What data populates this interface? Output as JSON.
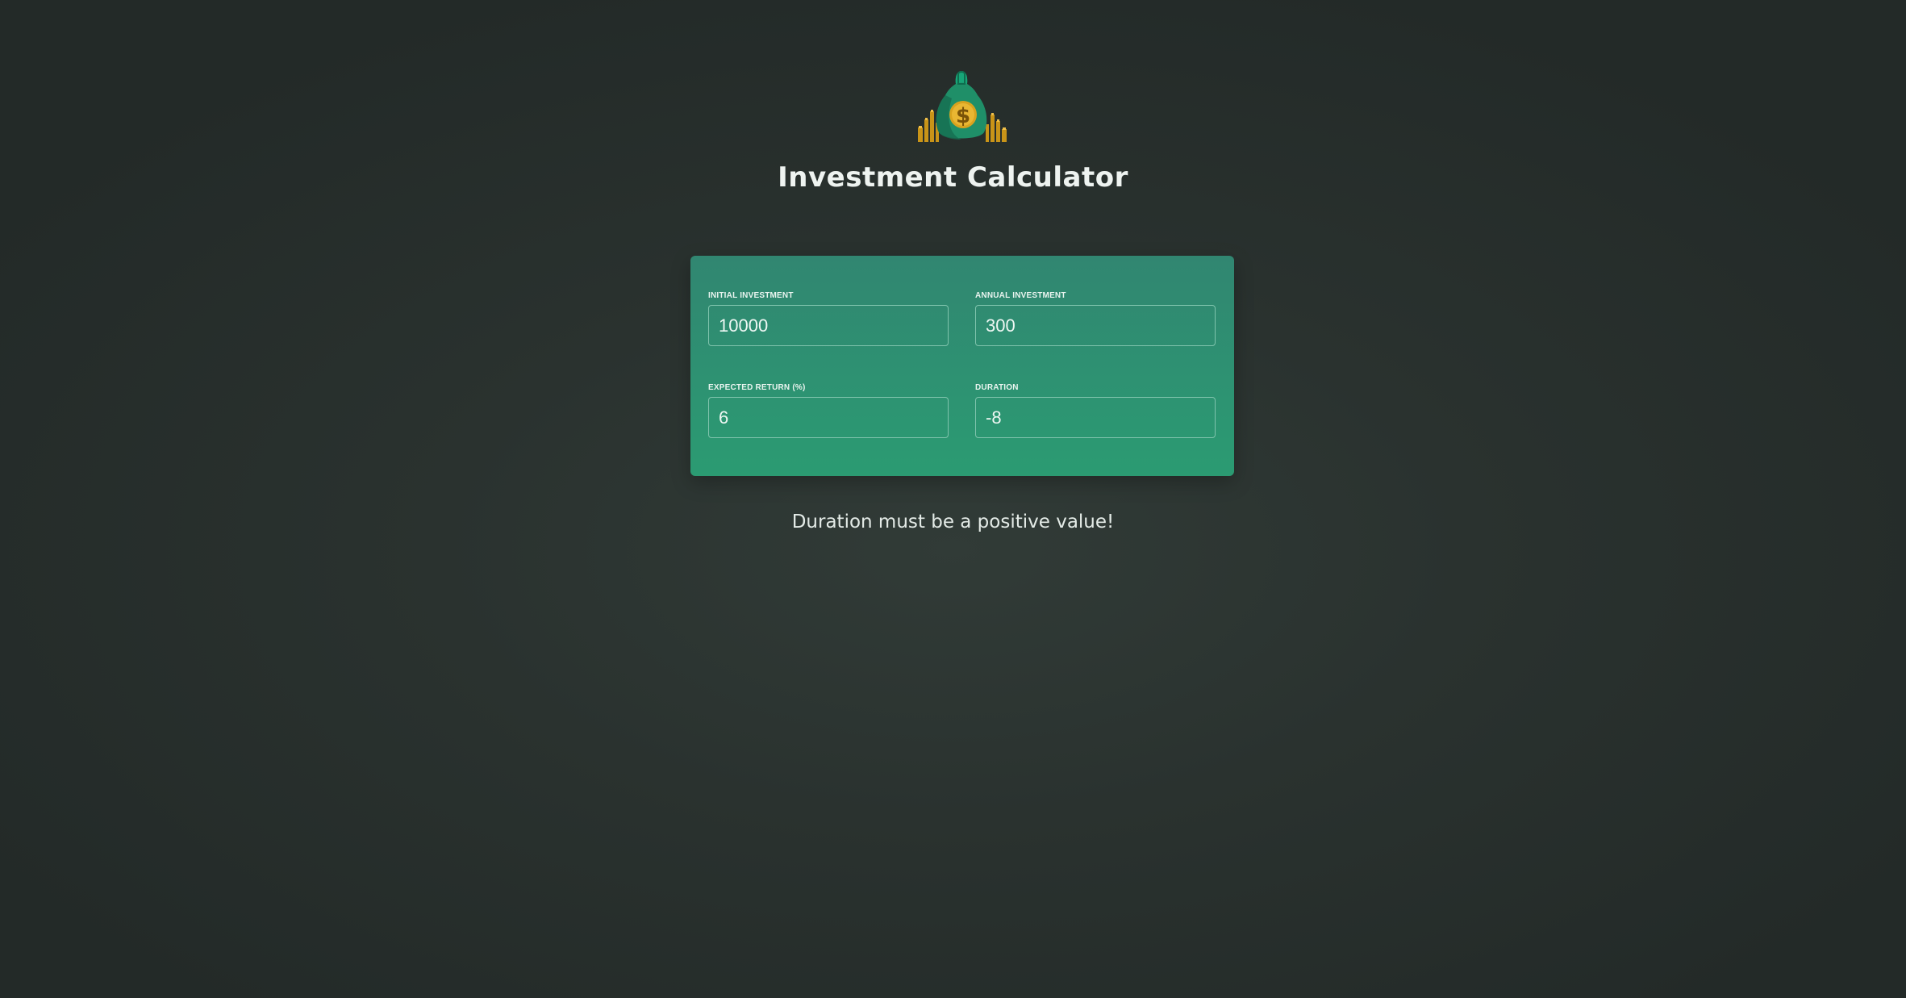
{
  "header": {
    "logo_icon": "money-bag-icon",
    "title": "Investment Calculator"
  },
  "form": {
    "initial_investment": {
      "label": "Initial Investment",
      "value": "10000"
    },
    "annual_investment": {
      "label": "Annual Investment",
      "value": "300"
    },
    "expected_return": {
      "label": "Expected Return (%)",
      "value": "6"
    },
    "duration": {
      "label": "Duration",
      "value": "-8"
    }
  },
  "message": "Duration must be a positive value!",
  "colors": {
    "background": "#2a322f",
    "panel_top": "#318671",
    "panel_bottom": "#2b9b72",
    "bag": "#1f9b70",
    "gold": "#d8a21e"
  }
}
